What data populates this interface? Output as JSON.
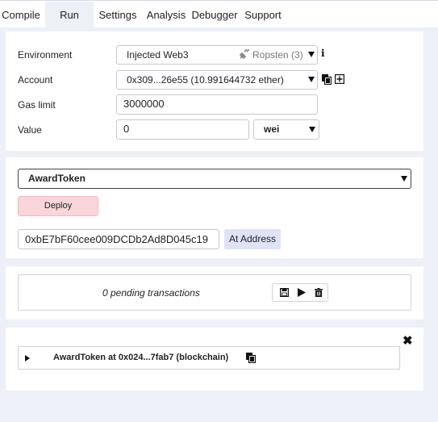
{
  "tabs": [
    {
      "label": "Compile"
    },
    {
      "label": "Run"
    },
    {
      "label": "Settings"
    },
    {
      "label": "Analysis"
    },
    {
      "label": "Debugger"
    },
    {
      "label": "Support"
    }
  ],
  "active_tab": "Run",
  "env_panel": {
    "environment": {
      "label": "Environment",
      "value": "Injected Web3",
      "network": "Ropsten (3)",
      "network_icon": "plug-icon",
      "info_icon": "info-icon"
    },
    "account": {
      "label": "Account",
      "value": "0x309...26e55 (10.991644732 ether)",
      "copy_icon": "copy-icon",
      "add_icon": "plus-square-icon"
    },
    "gas_limit": {
      "label": "Gas limit",
      "value": "3000000"
    },
    "value": {
      "label": "Value",
      "amount": "0",
      "unit": "wei"
    }
  },
  "contract_panel": {
    "selected_contract": "AwardToken",
    "deploy_label": "Deploy",
    "address_input": "0xbE7bF60cee009DCDb2Ad8D045c19",
    "at_address_label": "At Address"
  },
  "tx_panel": {
    "pending_text": "0 pending transactions",
    "icons": [
      "save-icon",
      "play-icon",
      "trash-icon"
    ]
  },
  "instances_panel": {
    "close_icon": "close-icon",
    "instance_label": "AwardToken at 0x024...7fab7 (blockchain)",
    "expand_icon": "triangle-right-icon",
    "copy_icon": "copy-icon"
  },
  "colors": {
    "page_bg": "#eef0f8",
    "panel_bg": "#ffffff",
    "deploy_bg": "#f8d6da",
    "at_address_bg": "#dfe3f6"
  }
}
